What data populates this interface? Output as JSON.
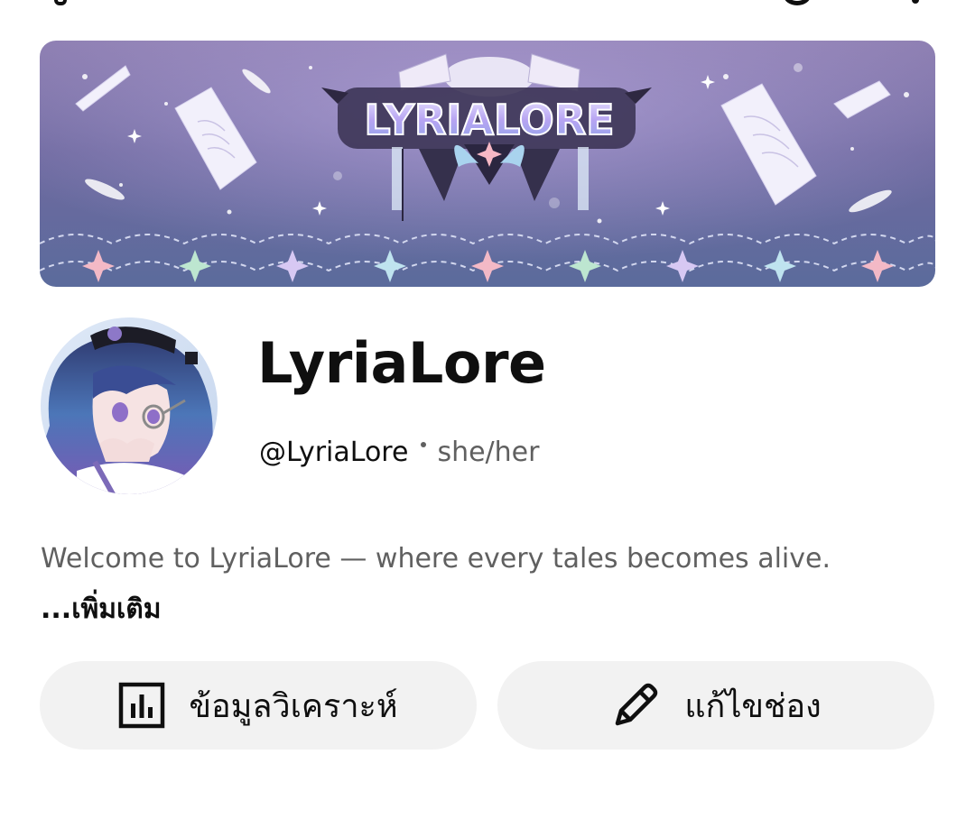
{
  "channel": {
    "name": "LyriaLore",
    "handle": "@LyriaLore",
    "pronouns": "she/her",
    "banner_logo_text": "LYRIALORE"
  },
  "description": {
    "text": "Welcome to LyriaLore — where every tales becomes alive. ",
    "more_label": "...เพิ่มเติม"
  },
  "actions": {
    "analytics_label": "ข้อมูลวิเคราะห์",
    "analytics_icon": "analytics-icon",
    "edit_label": "แก้ไขช่อง",
    "edit_icon": "pencil-icon"
  },
  "colors": {
    "button_bg": "#f2f2f2",
    "text_primary": "#0f0f0f",
    "text_secondary": "#606060"
  }
}
